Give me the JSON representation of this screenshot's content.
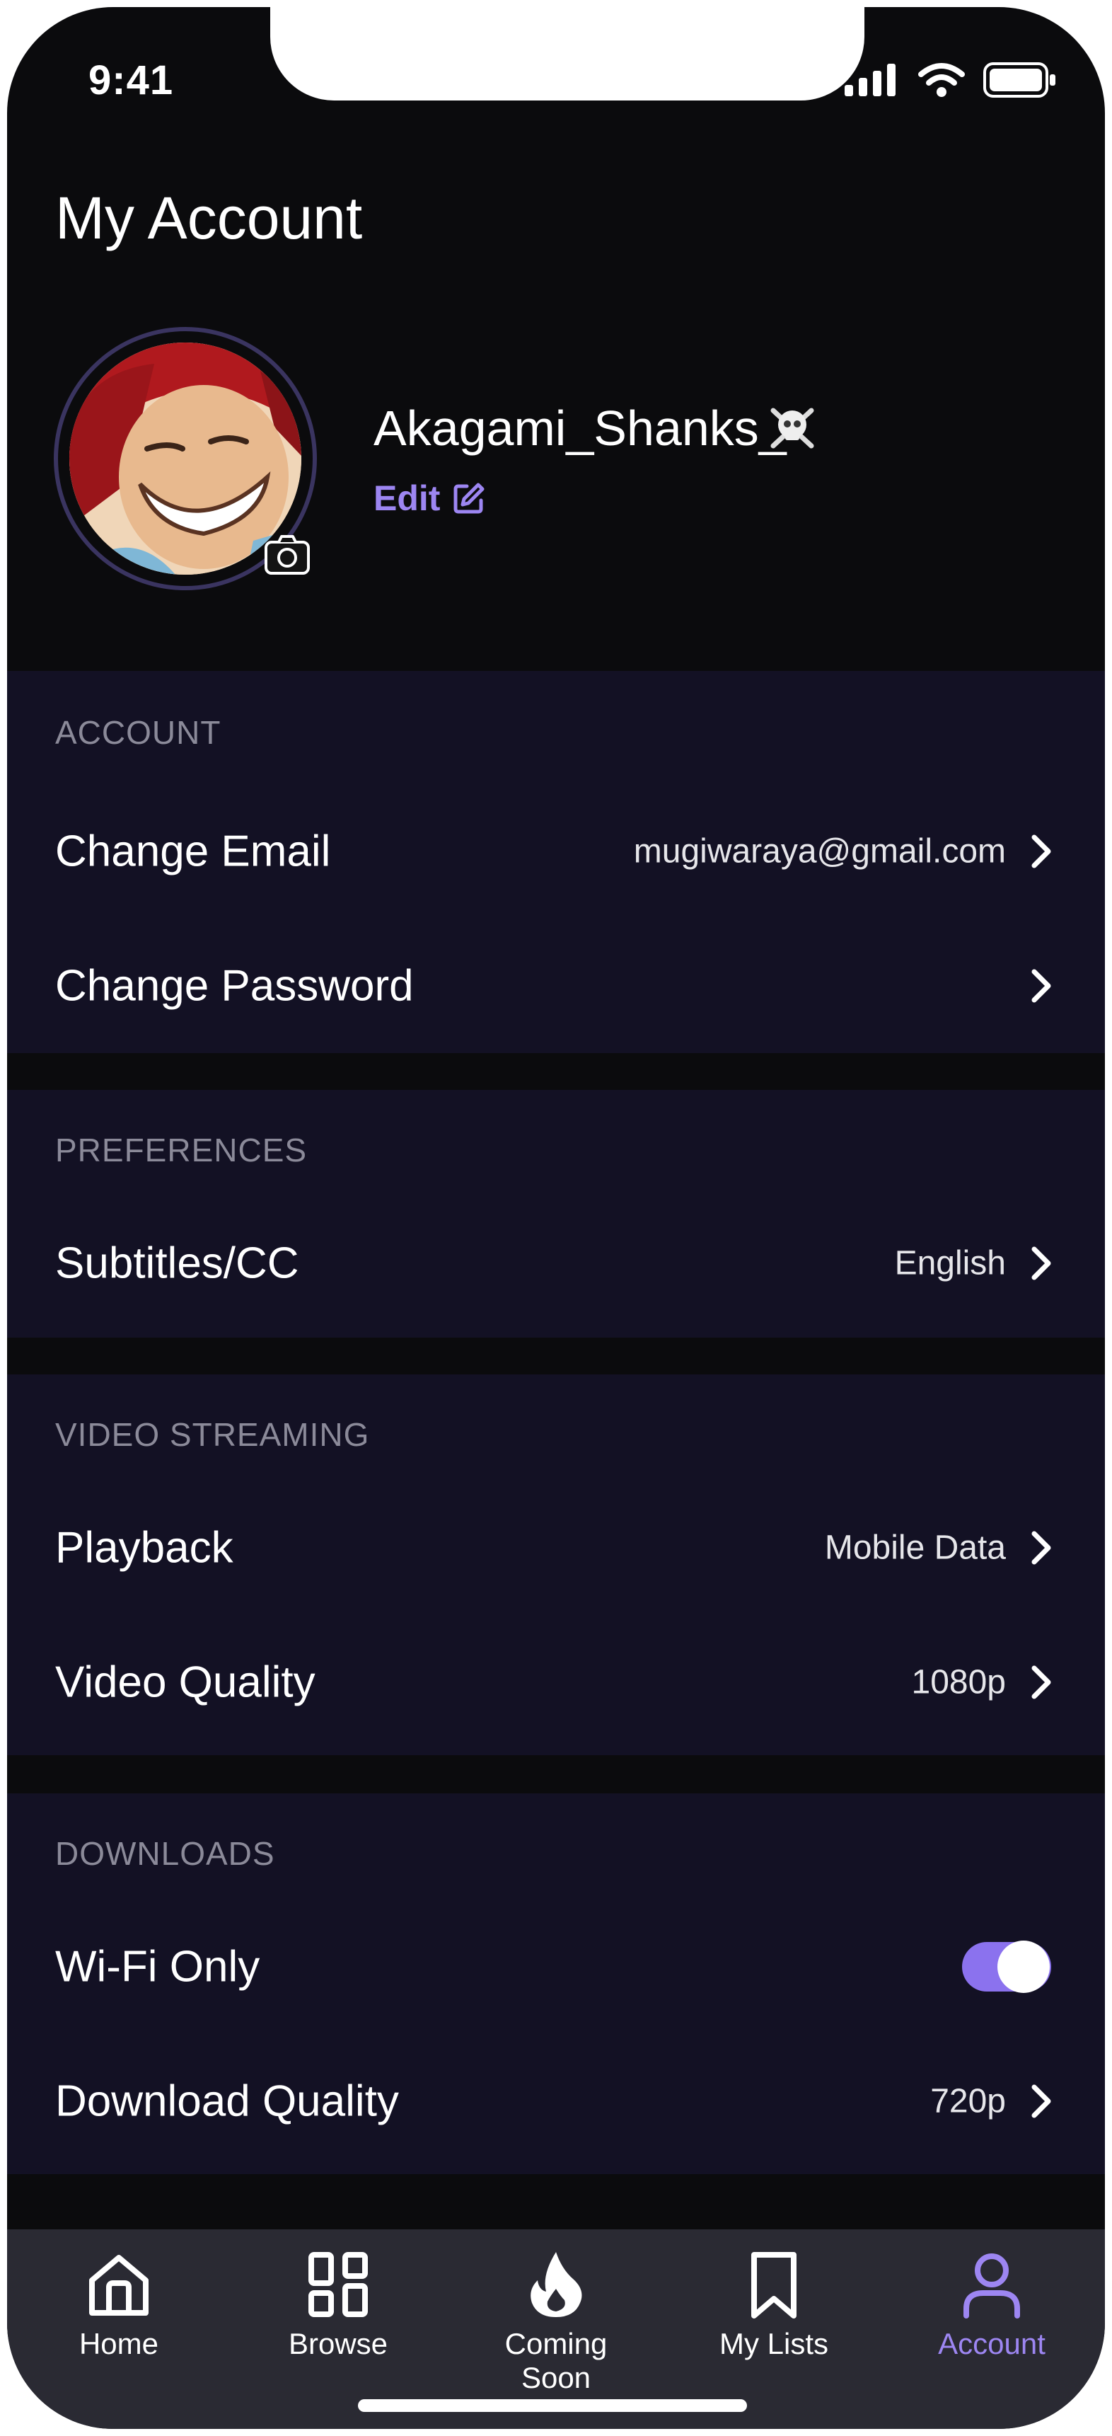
{
  "status_bar": {
    "time": "9:41"
  },
  "header": {
    "title": "My Account"
  },
  "profile": {
    "username": "Akagami_Shanks_",
    "edit_label": "Edit"
  },
  "sections": {
    "account": {
      "header": "ACCOUNT",
      "change_email": {
        "label": "Change Email",
        "value": "mugiwaraya@gmail.com"
      },
      "change_password": {
        "label": "Change Password"
      }
    },
    "preferences": {
      "header": "PREFERENCES",
      "subtitles": {
        "label": "Subtitles/CC",
        "value": "English"
      }
    },
    "video_streaming": {
      "header": "VIDEO STREAMING",
      "playback": {
        "label": "Playback",
        "value": "Mobile Data"
      },
      "video_quality": {
        "label": "Video Quality",
        "value": "1080p"
      }
    },
    "downloads": {
      "header": "DOWNLOADS",
      "wifi_only": {
        "label": "Wi-Fi Only",
        "enabled": true
      },
      "download_quality": {
        "label": "Download Quality",
        "value": "720p"
      }
    }
  },
  "tabbar": {
    "items": [
      {
        "label": "Home",
        "icon": "home-icon"
      },
      {
        "label": "Browse",
        "icon": "grid-icon"
      },
      {
        "label": "Coming Soon",
        "icon": "flame-icon"
      },
      {
        "label": "My Lists",
        "icon": "bookmark-icon"
      },
      {
        "label": "Account",
        "icon": "user-icon",
        "active": true
      }
    ]
  },
  "colors": {
    "accent": "#9d86f2",
    "background": "#0b0b0d",
    "section": "#131124",
    "tabbar": "#2a2a33"
  }
}
